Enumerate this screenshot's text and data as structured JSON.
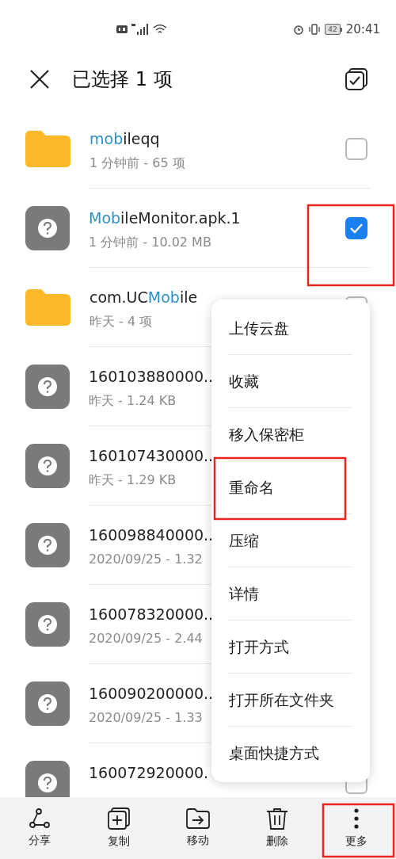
{
  "status_bar": {
    "battery": "42",
    "time": "20:41"
  },
  "header": {
    "title": "已选择 1 项"
  },
  "files": [
    {
      "kind": "folder",
      "name": [
        {
          "text": "mob",
          "highlighted": true
        },
        {
          "text": "ileqq",
          "highlighted": false
        }
      ],
      "detail": "1 分钟前 - 65 项",
      "checked": false
    },
    {
      "kind": "file",
      "name": [
        {
          "text": "Mob",
          "highlighted": true
        },
        {
          "text": "ileMonitor.apk.1",
          "highlighted": false
        }
      ],
      "detail": "1 分钟前 - 10.02 MB",
      "checked": true
    },
    {
      "kind": "folder",
      "name": [
        {
          "text": "com.UC",
          "highlighted": false
        },
        {
          "text": "Mob",
          "highlighted": true
        },
        {
          "text": "ile",
          "highlighted": false
        }
      ],
      "detail": "昨天 - 4 项",
      "checked": false
    },
    {
      "kind": "file",
      "name": [
        {
          "text": "160103880000..",
          "highlighted": false
        }
      ],
      "detail": "昨天 - 1.24 KB"
    },
    {
      "kind": "file",
      "name": [
        {
          "text": "160107430000..",
          "highlighted": false
        }
      ],
      "detail": "昨天 - 1.29 KB"
    },
    {
      "kind": "file",
      "name": [
        {
          "text": "160098840000..",
          "highlighted": false
        }
      ],
      "detail": "2020/09/25 - 1.32"
    },
    {
      "kind": "file",
      "name": [
        {
          "text": "160078320000..",
          "highlighted": false
        }
      ],
      "detail": "2020/09/25 - 2.44"
    },
    {
      "kind": "file",
      "name": [
        {
          "text": "160090200000..",
          "highlighted": false
        }
      ],
      "detail": "2020/09/25 - 1.33"
    },
    {
      "kind": "file",
      "name": [
        {
          "text": "160072920000.",
          "highlighted": false
        }
      ],
      "checked": false
    }
  ],
  "menu": [
    "上传云盘",
    "收藏",
    "移入保密柜",
    "重命名",
    "压缩",
    "详情",
    "打开方式",
    "打开所在文件夹",
    "桌面快捷方式"
  ],
  "toolbar": [
    {
      "kind": "share",
      "label": "分享"
    },
    {
      "kind": "copy",
      "label": "复制"
    },
    {
      "kind": "move",
      "label": "移动"
    },
    {
      "kind": "delete",
      "label": "删除"
    },
    {
      "kind": "more",
      "label": "更多"
    }
  ]
}
